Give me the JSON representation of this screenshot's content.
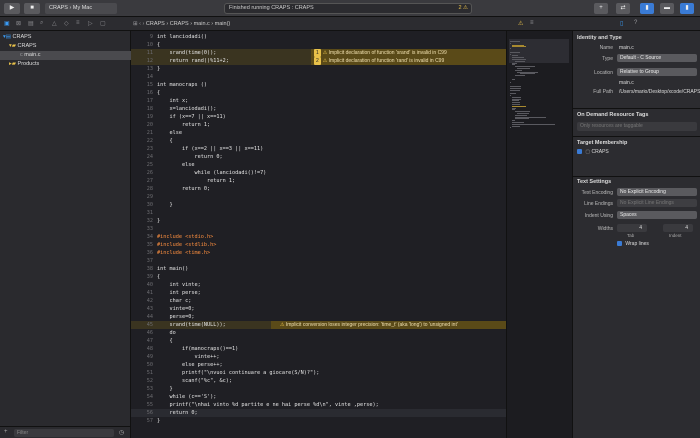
{
  "toolbar": {
    "scheme": "CRAPS",
    "destination": "My Mac",
    "activity": "Finished running CRAPS : CRAPS",
    "activity_warnings": "2"
  },
  "jumpbar": {
    "project": "CRAPS",
    "group": "CRAPS",
    "file": "main.c",
    "symbol": "main()"
  },
  "navigator": {
    "items": [
      {
        "label": "CRAPS"
      },
      {
        "label": "CRAPS"
      },
      {
        "label": "main.c"
      },
      {
        "label": "Products"
      }
    ],
    "filter_placeholder": "Filter"
  },
  "editor": {
    "lines": [
      {
        "n": "9",
        "t": "int lanciodadi()"
      },
      {
        "n": "10",
        "t": "{"
      },
      {
        "n": "11",
        "t": "    srand(time(0));"
      },
      {
        "n": "12",
        "t": "    return rand()%11+2;"
      },
      {
        "n": "13",
        "t": "}"
      },
      {
        "n": "14",
        "t": ""
      },
      {
        "n": "15",
        "t": "int manocraps ()"
      },
      {
        "n": "16",
        "t": "{"
      },
      {
        "n": "17",
        "t": "    int x;"
      },
      {
        "n": "18",
        "t": "    x=lanciodadi();"
      },
      {
        "n": "19",
        "t": "    if (x==7 || x==11)"
      },
      {
        "n": "20",
        "t": "        return 1;"
      },
      {
        "n": "21",
        "t": "    else"
      },
      {
        "n": "22",
        "t": "    {"
      },
      {
        "n": "23",
        "t": "        if (x==2 || x==3 || x==11)"
      },
      {
        "n": "24",
        "t": "            return 0;"
      },
      {
        "n": "25",
        "t": "        else"
      },
      {
        "n": "26",
        "t": "            while (lanciodadi()!=7)"
      },
      {
        "n": "27",
        "t": "                return 1;"
      },
      {
        "n": "28",
        "t": "        return 0;"
      },
      {
        "n": "29",
        "t": ""
      },
      {
        "n": "30",
        "t": "    }"
      },
      {
        "n": "31",
        "t": ""
      },
      {
        "n": "32",
        "t": "}"
      },
      {
        "n": "33",
        "t": ""
      },
      {
        "n": "34",
        "t": "#include <stdio.h>"
      },
      {
        "n": "35",
        "t": "#include <stdlib.h>"
      },
      {
        "n": "36",
        "t": "#include <time.h>"
      },
      {
        "n": "37",
        "t": ""
      },
      {
        "n": "38",
        "t": "int main()"
      },
      {
        "n": "39",
        "t": "{"
      },
      {
        "n": "40",
        "t": "    int vinte;"
      },
      {
        "n": "41",
        "t": "    int perse;"
      },
      {
        "n": "42",
        "t": "    char c;"
      },
      {
        "n": "43",
        "t": "    vinte=0;"
      },
      {
        "n": "44",
        "t": "    perse=0;"
      },
      {
        "n": "45",
        "t": "    srand(time(NULL));"
      },
      {
        "n": "46",
        "t": "    do"
      },
      {
        "n": "47",
        "t": "    {"
      },
      {
        "n": "48",
        "t": "        if(manocraps()==1)"
      },
      {
        "n": "49",
        "t": "            vinte++;"
      },
      {
        "n": "50",
        "t": "        else perse++;"
      },
      {
        "n": "51",
        "t": "        printf(\"\\nvuoi continuare a giocare(S/N)?\");"
      },
      {
        "n": "52",
        "t": "        scanf(\"%c\", &c);"
      },
      {
        "n": "53",
        "t": "    }"
      },
      {
        "n": "54",
        "t": "    while (c=='S');"
      },
      {
        "n": "55",
        "t": "    printf(\"\\nhai vinto %d partite e ne hai perse %d\\n\", vinte ,perse);"
      },
      {
        "n": "56",
        "t": "    return 0;"
      },
      {
        "n": "57",
        "t": "}"
      }
    ],
    "annotations": [
      {
        "count": "1",
        "text": "Implicit declaration of function 'srand' is invalid in C99"
      },
      {
        "count": "2",
        "text": "Implicit declaration of function 'rand' is invalid in C99"
      },
      {
        "count": "",
        "text": "Implicit conversion loses integer precision: 'time_t' (aka 'long') to 'unsigned int'"
      }
    ]
  },
  "inspector": {
    "identity_title": "Identity and Type",
    "name_label": "Name",
    "name_value": "main.c",
    "type_label": "Type",
    "type_value": "Default - C Source",
    "location_label": "Location",
    "location_value": "Relative to Group",
    "location_file": "main.c",
    "fullpath_label": "Full Path",
    "fullpath_value": "/Users/mario/Desktop/xcode/CRAPS/CRAPS/main.c",
    "odr_title": "On Demand Resource Tags",
    "odr_placeholder": "Only resources are taggable",
    "target_title": "Target Membership",
    "target_item": "CRAPS",
    "text_title": "Text Settings",
    "encoding_label": "Text Encoding",
    "encoding_value": "No Explicit Encoding",
    "endings_label": "Line Endings",
    "endings_value": "No Explicit Line Endings",
    "indent_label": "Indent Using",
    "indent_value": "Spaces",
    "widths_label": "Widths",
    "tab_width": "4",
    "indent_width": "4",
    "tab_label": "Tab",
    "indent_sub_label": "Indent",
    "wrap_label": "Wrap lines"
  }
}
